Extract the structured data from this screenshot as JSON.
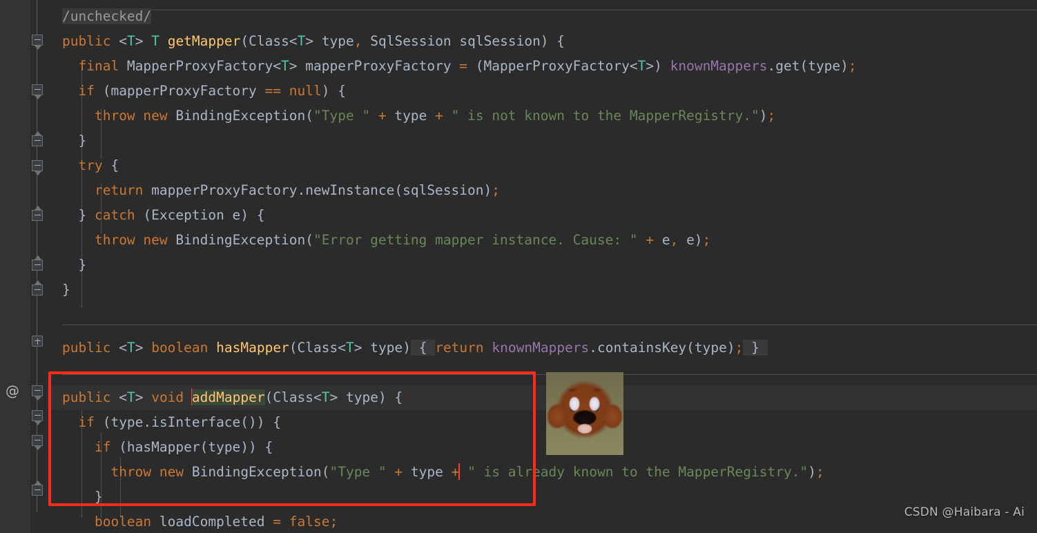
{
  "editor": {
    "theme": "darcula",
    "background": "#2b2b2b",
    "gutter_background": "#313335",
    "caret_line_background": "#323232",
    "colors": {
      "keyword": "#cc7832",
      "string": "#6a8759",
      "field": "#9876aa",
      "method": "#ffc66d",
      "type_param": "#4ec9a8",
      "text": "#a9b7c6",
      "comment": "#808080",
      "annotation_box": "#ff2b1a",
      "caret": "#ff3b30",
      "fold_background": "#3a3a3a",
      "identifier_highlight": "#3b473a"
    }
  },
  "gutter": {
    "override_icon": "@",
    "fold_markers": [
      {
        "type": "collapsed-comment",
        "glyph": "-"
      },
      {
        "type": "expanded-method",
        "glyph": "-"
      },
      {
        "type": "expanded-block",
        "glyph": "-"
      },
      {
        "type": "end-block",
        "glyph": "-"
      },
      {
        "type": "expanded-try",
        "glyph": "-"
      },
      {
        "type": "end-try",
        "glyph": "-"
      },
      {
        "type": "end-catch",
        "glyph": "-"
      },
      {
        "type": "end-method",
        "glyph": "-"
      },
      {
        "type": "collapsed-method",
        "glyph": "+"
      },
      {
        "type": "expanded-method",
        "glyph": "-"
      },
      {
        "type": "expanded-if",
        "glyph": "-"
      },
      {
        "type": "expanded-if-inner",
        "glyph": "-"
      },
      {
        "type": "end-if",
        "glyph": "-"
      }
    ]
  },
  "code_lines": [
    {
      "n": 1,
      "indent": 0,
      "text": "/unchecked/",
      "kind": "folded-comment"
    },
    {
      "n": 2,
      "indent": 0,
      "text": "public <T> T getMapper(Class<T> type, SqlSession sqlSession) {"
    },
    {
      "n": 3,
      "indent": 1,
      "text": "final MapperProxyFactory<T> mapperProxyFactory = (MapperProxyFactory<T>) knownMappers.get(type);"
    },
    {
      "n": 4,
      "indent": 1,
      "text": "if (mapperProxyFactory == null) {"
    },
    {
      "n": 5,
      "indent": 2,
      "text": "throw new BindingException(\"Type \" + type + \" is not known to the MapperRegistry.\");"
    },
    {
      "n": 6,
      "indent": 1,
      "text": "}"
    },
    {
      "n": 7,
      "indent": 1,
      "text": "try {"
    },
    {
      "n": 8,
      "indent": 2,
      "text": "return mapperProxyFactory.newInstance(sqlSession);"
    },
    {
      "n": 9,
      "indent": 1,
      "text": "} catch (Exception e) {"
    },
    {
      "n": 10,
      "indent": 2,
      "text": "throw new BindingException(\"Error getting mapper instance. Cause: \" + e, e);"
    },
    {
      "n": 11,
      "indent": 1,
      "text": "}"
    },
    {
      "n": 12,
      "indent": 0,
      "text": "}"
    },
    {
      "n": 13,
      "indent": 0,
      "text": ""
    },
    {
      "n": 14,
      "indent": 0,
      "text": "public <T> boolean hasMapper(Class<T> type) { return knownMappers.containsKey(type); }",
      "kind": "folded-body"
    },
    {
      "n": 15,
      "indent": 0,
      "text": ""
    },
    {
      "n": 16,
      "indent": 0,
      "text": "public <T> void addMapper(Class<T> type) {",
      "kind": "caret-line",
      "caret_before": "addMapper",
      "highlighted_identifier": "addMapper"
    },
    {
      "n": 17,
      "indent": 1,
      "text": "if (type.isInterface()) {"
    },
    {
      "n": 18,
      "indent": 2,
      "text": "if (hasMapper(type)) {"
    },
    {
      "n": 19,
      "indent": 3,
      "text": "throw new BindingException(\"Type \" + type + \" is already known to the MapperRegistry.\");"
    },
    {
      "n": 20,
      "indent": 2,
      "text": "}"
    },
    {
      "n": 21,
      "indent": 2,
      "text": "boolean loadCompleted = false;"
    }
  ],
  "annotation": {
    "type": "red-rectangle",
    "covers_lines": [
      16,
      17,
      18,
      19,
      20
    ]
  },
  "overlay_image": {
    "name": "jerry-meme-thumbnail",
    "description": "blurry brown cartoon mouse face meme"
  },
  "watermark": {
    "text": "CSDN @Haibara - Ai"
  }
}
